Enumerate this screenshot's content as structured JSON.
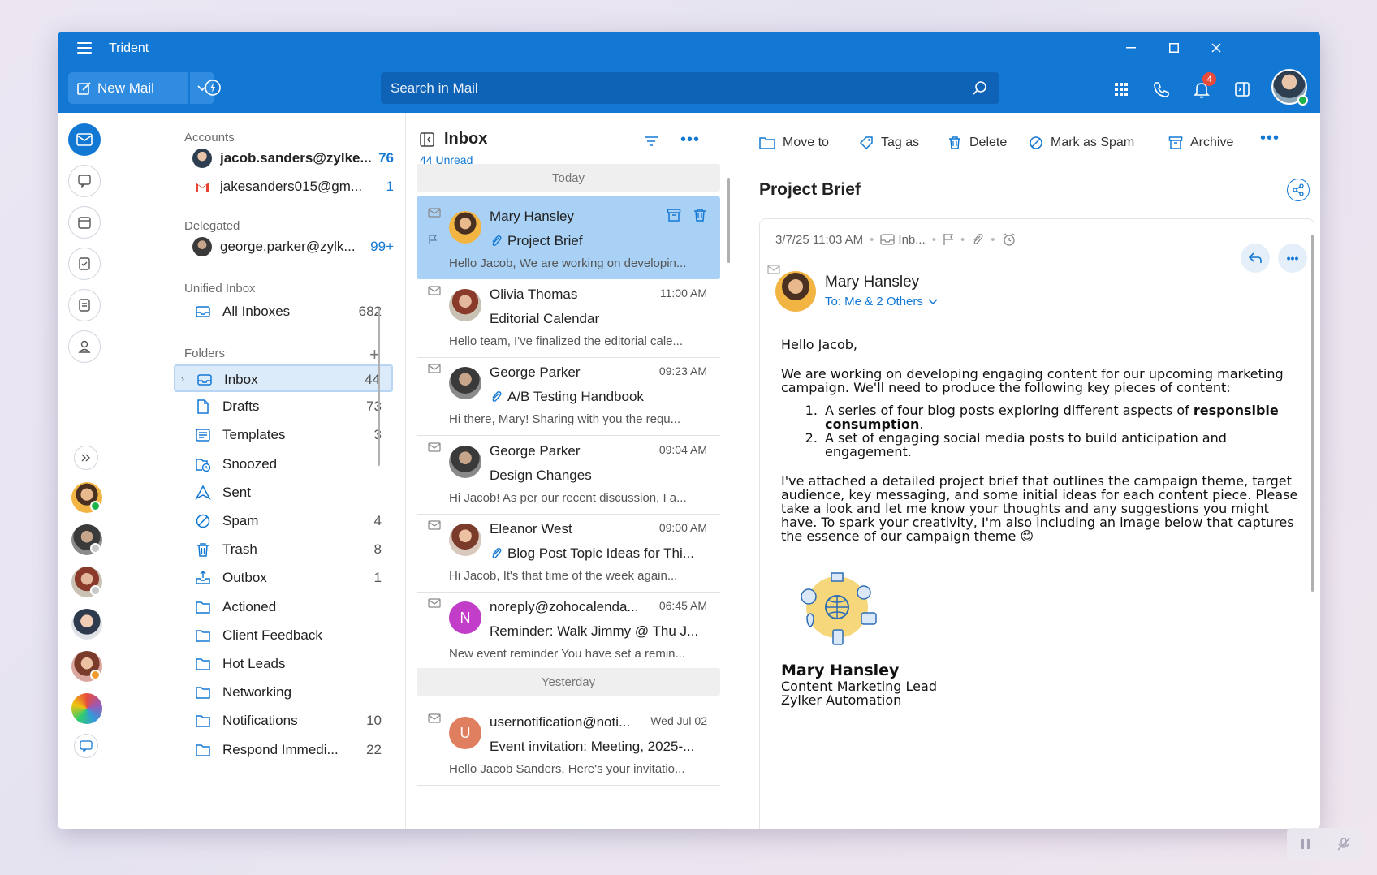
{
  "app": {
    "title": "Trident",
    "new_mail_label": "New Mail",
    "search_placeholder": "Search in Mail",
    "notification_count": "4",
    "brand_color": "#1278d4"
  },
  "accounts": {
    "label": "Accounts",
    "items": [
      {
        "name": "jacob.sanders@zylke...",
        "count": "76"
      },
      {
        "name": "jakesanders015@gm...",
        "count": "1"
      }
    ]
  },
  "delegated": {
    "label": "Delegated",
    "items": [
      {
        "name": "george.parker@zylk...",
        "count": "99+"
      }
    ]
  },
  "unified": {
    "label": "Unified Inbox",
    "all_inboxes": {
      "name": "All Inboxes",
      "count": "682"
    }
  },
  "folders": {
    "label": "Folders",
    "items": [
      {
        "name": "Inbox",
        "count": "44",
        "icon": "inbox-icon"
      },
      {
        "name": "Drafts",
        "count": "73",
        "icon": "draft-icon"
      },
      {
        "name": "Templates",
        "count": "3",
        "icon": "template-icon"
      },
      {
        "name": "Snoozed",
        "count": "",
        "icon": "snooze-icon"
      },
      {
        "name": "Sent",
        "count": "",
        "icon": "sent-icon"
      },
      {
        "name": "Spam",
        "count": "4",
        "icon": "spam-icon"
      },
      {
        "name": "Trash",
        "count": "8",
        "icon": "trash-icon"
      },
      {
        "name": "Outbox",
        "count": "1",
        "icon": "outbox-icon"
      },
      {
        "name": "Actioned",
        "count": "",
        "icon": "folder-icon"
      },
      {
        "name": "Client Feedback",
        "count": "",
        "icon": "folder-icon"
      },
      {
        "name": "Hot Leads",
        "count": "",
        "icon": "folder-icon"
      },
      {
        "name": "Networking",
        "count": "",
        "icon": "folder-icon"
      },
      {
        "name": "Notifications",
        "count": "10",
        "icon": "folder-icon"
      },
      {
        "name": "Respond Immedi...",
        "count": "22",
        "icon": "folder-icon"
      }
    ]
  },
  "list": {
    "title": "Inbox",
    "unread": "44 Unread",
    "group_today": "Today",
    "group_yesterday": "Yesterday",
    "messages": [
      {
        "from": "Mary Hansley",
        "time": "",
        "subject": "Project Brief",
        "preview": "Hello Jacob, We are working on developin...",
        "attachment": true,
        "letter": ""
      },
      {
        "from": "Olivia Thomas",
        "time": "11:00 AM",
        "subject": "Editorial Calendar",
        "preview": "Hello team, I've finalized the editorial cale...",
        "attachment": false,
        "letter": ""
      },
      {
        "from": "George Parker",
        "time": "09:23 AM",
        "subject": "A/B Testing Handbook",
        "preview": "Hi there, Mary! Sharing with you the requ...",
        "attachment": true,
        "letter": ""
      },
      {
        "from": "George Parker",
        "time": "09:04 AM",
        "subject": "Design Changes",
        "preview": "Hi Jacob! As per our recent discussion, I a...",
        "attachment": false,
        "letter": ""
      },
      {
        "from": "Eleanor West",
        "time": "09:00 AM",
        "subject": "Blog Post Topic Ideas for Thi...",
        "preview": "Hi Jacob, It's that time of the week again...",
        "attachment": true,
        "letter": ""
      },
      {
        "from": "noreply@zohocalenda...",
        "time": "06:45 AM",
        "subject": "Reminder: Walk Jimmy @ Thu J...",
        "preview": "New event reminder You have set a remin...",
        "attachment": false,
        "letter": "N"
      },
      {
        "from": "usernotification@noti...",
        "time": "Wed Jul 02",
        "subject": "Event invitation: Meeting, 2025-...",
        "preview": "Hello Jacob Sanders, Here's your invitatio...",
        "attachment": false,
        "letter": "U"
      }
    ]
  },
  "reading": {
    "toolbar": {
      "move_to": "Move to",
      "tag_as": "Tag as",
      "delete": "Delete",
      "mark_spam": "Mark as Spam",
      "archive": "Archive"
    },
    "subject": "Project Brief",
    "meta_date": "3/7/25 11:03 AM",
    "meta_folder": "Inb...",
    "sender": "Mary Hansley",
    "to": "To: Me & 2 Others",
    "greeting": "Hello Jacob,",
    "para1": "We are working on developing engaging content for our upcoming marketing campaign. We'll need to produce the following key pieces of content:",
    "item1_pre": "A series of four blog posts exploring different aspects of ",
    "item1_bold": "responsible consumption",
    "item1_post": ".",
    "item2": "A set of engaging social media posts to build anticipation and engagement.",
    "para2": "I've attached a detailed project brief that outlines the campaign theme, target audience, key messaging, and some initial ideas for each content piece. Please take a look and let me know your thoughts and any suggestions you might have. To spark your creativity, I'm also including an image below that captures the essence of our campaign theme 😊",
    "sig_name": "Mary Hansley",
    "sig_title": "Content Marketing Lead",
    "sig_company": "Zylker Automation"
  }
}
